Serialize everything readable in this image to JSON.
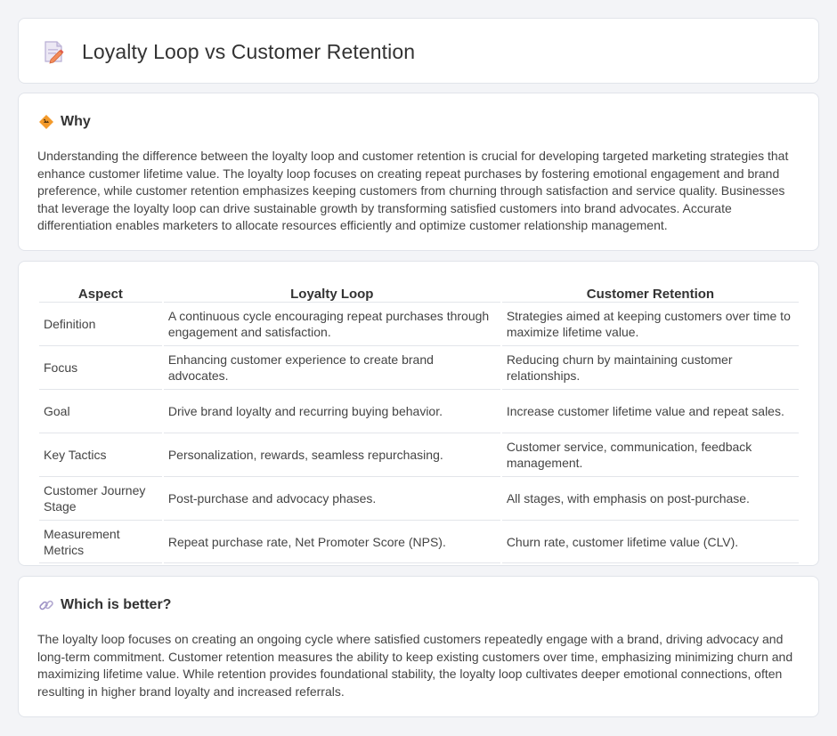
{
  "header": {
    "title": "Loyalty Loop vs Customer Retention",
    "icon": "document-pencil-icon"
  },
  "why": {
    "title": "Why",
    "icon": "diamond-sign-icon",
    "body": "Understanding the difference between the loyalty loop and customer retention is crucial for developing targeted marketing strategies that enhance customer lifetime value. The loyalty loop focuses on creating repeat purchases by fostering emotional engagement and brand preference, while customer retention emphasizes keeping customers from churning through satisfaction and service quality. Businesses that leverage the loyalty loop can drive sustainable growth by transforming satisfied customers into brand advocates. Accurate differentiation enables marketers to allocate resources efficiently and optimize customer relationship management."
  },
  "comparison": {
    "headers": [
      "Aspect",
      "Loyalty Loop",
      "Customer Retention"
    ],
    "rows": [
      [
        "Definition",
        "A continuous cycle encouraging repeat purchases through engagement and satisfaction.",
        "Strategies aimed at keeping customers over time to maximize lifetime value."
      ],
      [
        "Focus",
        "Enhancing customer experience to create brand advocates.",
        "Reducing churn by maintaining customer relationships."
      ],
      [
        "Goal",
        "Drive brand loyalty and recurring buying behavior.",
        "Increase customer lifetime value and repeat sales."
      ],
      [
        "Key Tactics",
        "Personalization, rewards, seamless repurchasing.",
        "Customer service, communication, feedback management."
      ],
      [
        "Customer Journey Stage",
        "Post-purchase and advocacy phases.",
        "All stages, with emphasis on post-purchase."
      ],
      [
        "Measurement Metrics",
        "Repeat purchase rate, Net Promoter Score (NPS).",
        "Churn rate, customer lifetime value (CLV)."
      ]
    ]
  },
  "better": {
    "title": "Which is better?",
    "icon": "link-icon",
    "body": "The loyalty loop focuses on creating an ongoing cycle where satisfied customers repeatedly engage with a brand, driving advocacy and long-term commitment. Customer retention measures the ability to keep existing customers over time, emphasizing minimizing churn and maximizing lifetime value. While retention provides foundational stability, the loyalty loop cultivates deeper emotional connections, often resulting in higher brand loyalty and increased referrals."
  },
  "colors": {
    "page_background": "#f3f4f7",
    "card_background": "#ffffff",
    "border": "#e1e4ea",
    "accent_orange": "#f39a2b",
    "icon_purple": "#9b8fc4"
  }
}
